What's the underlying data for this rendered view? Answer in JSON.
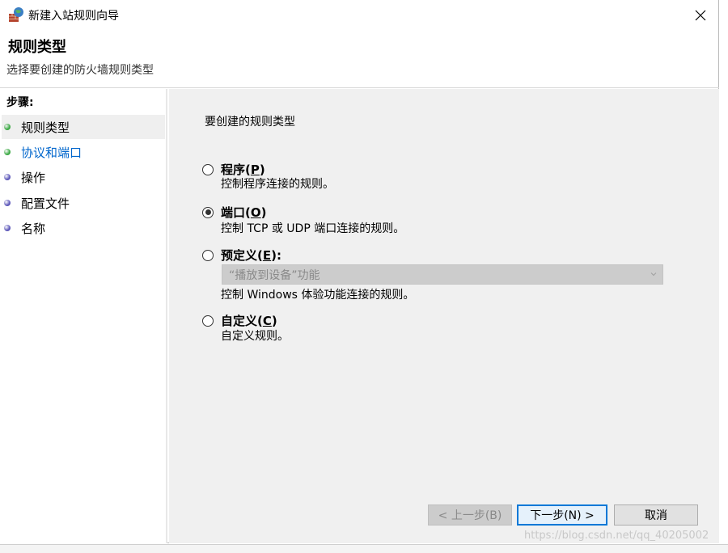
{
  "window": {
    "title": "新建入站规则向导"
  },
  "header": {
    "title": "规则类型",
    "subtitle": "选择要创建的防火墙规则类型"
  },
  "sidebar": {
    "steps_label": "步骤:",
    "items": [
      {
        "label": "规则类型",
        "dot_color": "#3aa843",
        "link": false,
        "active": true
      },
      {
        "label": "协议和端口",
        "dot_color": "#3aa843",
        "link": true,
        "active": false
      },
      {
        "label": "操作",
        "dot_color": "#5a55b8",
        "link": false,
        "active": false
      },
      {
        "label": "配置文件",
        "dot_color": "#5a55b8",
        "link": false,
        "active": false
      },
      {
        "label": "名称",
        "dot_color": "#5a55b8",
        "link": false,
        "active": false
      }
    ]
  },
  "main": {
    "question": "要创建的规则类型",
    "options": [
      {
        "label": "程序",
        "mnemonic": "P",
        "suffix": "",
        "description": "控制程序连接的规则。",
        "selected": false
      },
      {
        "label": "端口",
        "mnemonic": "O",
        "suffix": "",
        "description": "控制 TCP 或 UDP 端口连接的规则。",
        "selected": true
      },
      {
        "label": "预定义",
        "mnemonic": "E",
        "suffix": ":",
        "description": "控制 Windows 体验功能连接的规则。",
        "selected": false
      },
      {
        "label": "自定义",
        "mnemonic": "C",
        "suffix": "",
        "description": "自定义规则。",
        "selected": false
      }
    ],
    "predefined_dropdown": {
      "value": "“播放到设备”功能",
      "enabled": false
    }
  },
  "buttons": {
    "back": "< 上一步(B)",
    "next": "下一步(N) >",
    "cancel": "取消"
  },
  "watermark": "https://blog.csdn.net/qq_40205002",
  "colors": {
    "link": "#0066cc",
    "content_bg": "#f0f0f0",
    "accent": "#0078d7"
  }
}
